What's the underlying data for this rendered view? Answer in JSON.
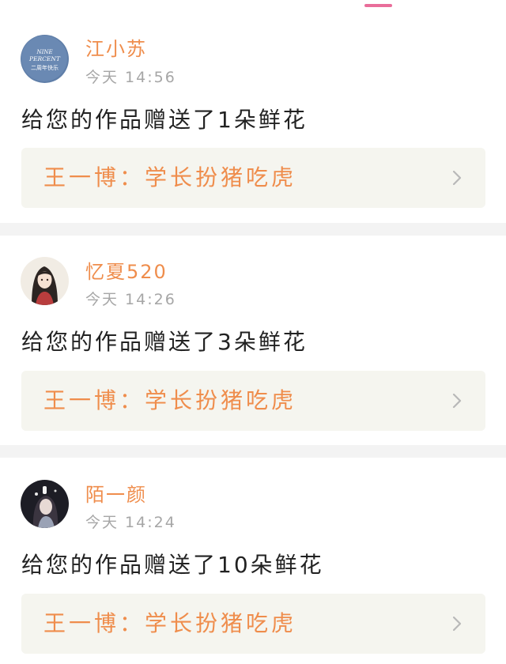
{
  "notifications": [
    {
      "username": "江小苏",
      "time": "今天 14:56",
      "avatar_text_line1": "NINE",
      "avatar_text_line2": "PERCENT",
      "avatar_text_line3": "二周年快乐",
      "message": "给您的作品赠送了1朵鲜花",
      "work_title": "王一博：学长扮猪吃虎"
    },
    {
      "username": "忆夏520",
      "time": "今天 14:26",
      "message": "给您的作品赠送了3朵鲜花",
      "work_title": "王一博：学长扮猪吃虎"
    },
    {
      "username": "陌一颜",
      "time": "今天 14:24",
      "message": "给您的作品赠送了10朵鲜花",
      "work_title": "王一博：学长扮猪吃虎"
    }
  ],
  "colors": {
    "accent": "#ef8d4c",
    "tab_indicator": "#e96d9a",
    "link_background": "#f5f5ef",
    "divider": "#f3f3f3"
  },
  "icons": [
    "chevron-right-icon",
    "avatar-image"
  ]
}
